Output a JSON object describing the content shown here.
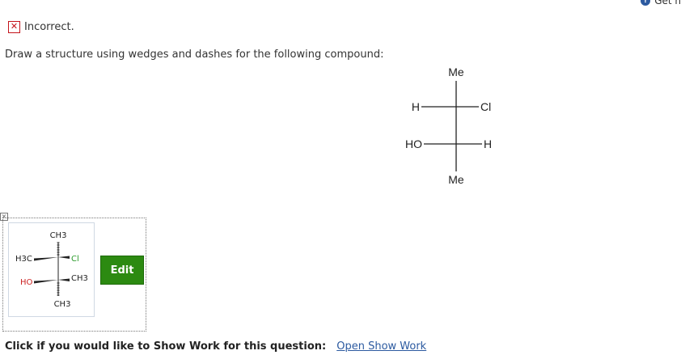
{
  "help": {
    "label": "Get h"
  },
  "status": {
    "text": "Incorrect."
  },
  "question": {
    "instructions": "Draw a structure using wedges and dashes for the following compound:",
    "fischer": {
      "top": "Me",
      "row1_left": "H",
      "row1_right": "Cl",
      "row2_left": "HO",
      "row2_right": "H",
      "bottom": "Me"
    }
  },
  "answer": {
    "close_icon": "×",
    "structure": {
      "top": "CH3",
      "left_top": "H3C",
      "right_top": "Cl",
      "left_bottom": "HO",
      "right_bottom": "CH3",
      "bottom": "CH3"
    },
    "edit_label": "Edit"
  },
  "show_work": {
    "prompt": "Click if you would like to Show Work for this question:",
    "link": "Open Show Work"
  },
  "colors": {
    "incorrect": "#c4141b",
    "edit_button": "#2c8a11",
    "link": "#2c5aa0",
    "chlorine": "#2a9a2a",
    "oxygen": "#cc2222"
  }
}
